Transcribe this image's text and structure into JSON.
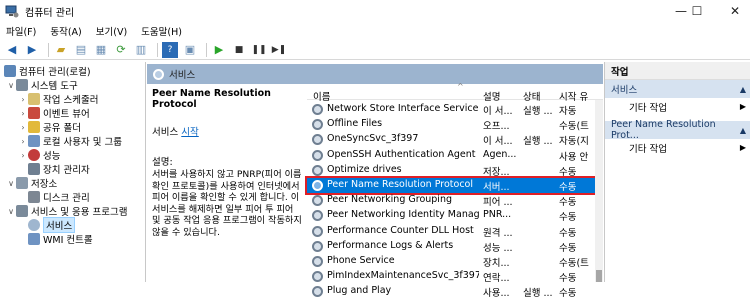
{
  "window": {
    "title": "컴퓨터 관리",
    "min": "—",
    "max": "☐",
    "close": "✕"
  },
  "menu": [
    "파일(F)",
    "동작(A)",
    "보기(V)",
    "도움말(H)"
  ],
  "tree": {
    "root": "컴퓨터 관리(로컬)",
    "system_tools": "시스템 도구",
    "task_scheduler": "작업 스케줄러",
    "event_viewer": "이벤트 뷰어",
    "shared_folders": "공유 폴더",
    "local_users": "로컬 사용자 및 그룹",
    "performance": "성능",
    "device_manager": "장치 관리자",
    "storage": "저장소",
    "disk_management": "디스크 관리",
    "services_apps": "서비스 및 응용 프로그램",
    "services": "서비스",
    "wmi": "WMI 컨트롤"
  },
  "panel": {
    "header": "서비스",
    "desc_title": "Peer Name Resolution Protocol",
    "service_prefix": "서비스",
    "start_link": "시작",
    "desc_label": "설명:",
    "desc_text": "서버를 사용하지 않고 PNRP(피어 이름 확인 프로토콜)를 사용하여 인터넷에서 피어 이름을 확인할 수 있게 합니다. 이 서비스를 해제하면 일부 피어 투 피어 및 공동 작업 응용 프로그램이 작동하지 않을 수 있습니다."
  },
  "list": {
    "sort_indicator": "^",
    "columns": {
      "name": "이름",
      "desc": "설명",
      "status": "상태",
      "startup": "시작 유"
    },
    "rows": [
      {
        "name": "Network Store Interface Service",
        "desc": "이 서...",
        "status": "실행 ...",
        "startup": "자동"
      },
      {
        "name": "Offline Files",
        "desc": "오프...",
        "status": "",
        "startup": "수동(트"
      },
      {
        "name": "OneSyncSvc_3f397",
        "desc": "이 서...",
        "status": "실행 ...",
        "startup": "자동(지"
      },
      {
        "name": "OpenSSH Authentication Agent",
        "desc": "Agen...",
        "status": "",
        "startup": "사용 안"
      },
      {
        "name": "Optimize drives",
        "desc": "저장...",
        "status": "",
        "startup": "수동"
      },
      {
        "name": "Peer Name Resolution Protocol",
        "desc": "서버...",
        "status": "",
        "startup": "수동"
      },
      {
        "name": "Peer Networking Grouping",
        "desc": "피어 ...",
        "status": "",
        "startup": "수동"
      },
      {
        "name": "Peer Networking Identity Manager",
        "desc": "PNR...",
        "status": "",
        "startup": "수동"
      },
      {
        "name": "Performance Counter DLL Host",
        "desc": "원격 ...",
        "status": "",
        "startup": "수동"
      },
      {
        "name": "Performance Logs & Alerts",
        "desc": "성능 ...",
        "status": "",
        "startup": "수동"
      },
      {
        "name": "Phone Service",
        "desc": "장치...",
        "status": "",
        "startup": "수동(트"
      },
      {
        "name": "PimIndexMaintenanceSvc_3f397",
        "desc": "연락...",
        "status": "",
        "startup": "수동"
      },
      {
        "name": "Plug and Play",
        "desc": "사용...",
        "status": "실행 ...",
        "startup": "수동"
      }
    ],
    "selected_index": 5
  },
  "actions": {
    "header": "작업",
    "group1": "서비스",
    "more1": "기타 작업",
    "group2": "Peer Name Resolution Prot...",
    "more2": "기타 작업"
  },
  "colors": {
    "selection": "#0078d7",
    "highlight_border": "#e01f26",
    "header": "#9cb4cf"
  }
}
